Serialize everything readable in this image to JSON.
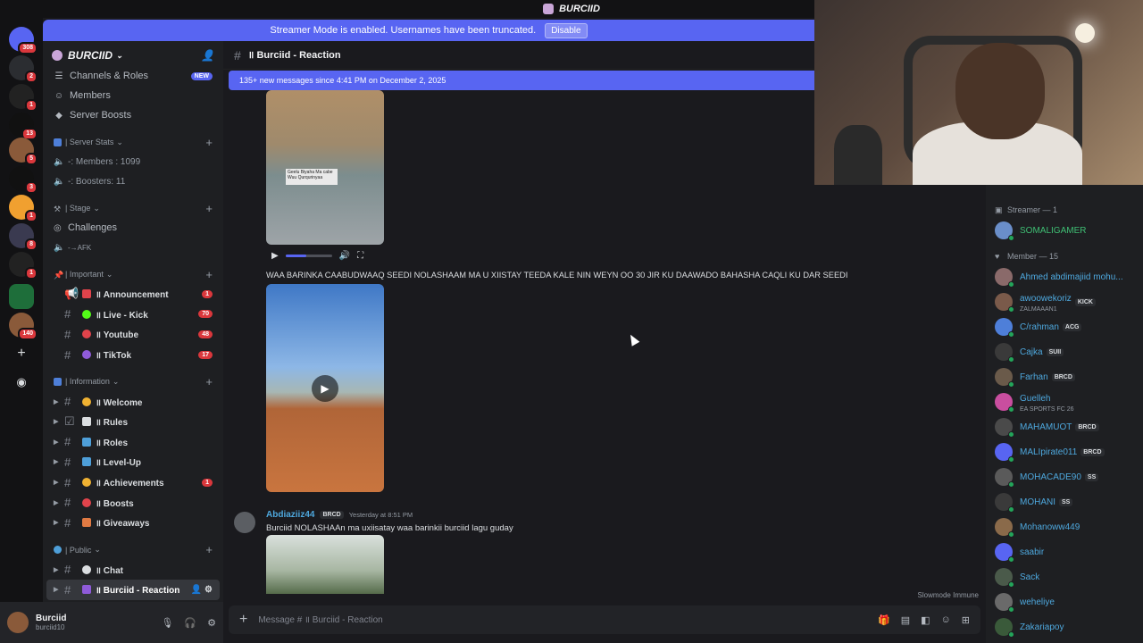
{
  "window": {
    "title": "BURCIID"
  },
  "streamer_banner": {
    "text": "Streamer Mode is enabled. Usernames have been truncated.",
    "button": "Disable"
  },
  "rail": [
    {
      "badge": "308"
    },
    {
      "badge": "2"
    },
    {
      "badge": "1"
    },
    {
      "badge": "13"
    },
    {
      "badge": "5"
    },
    {
      "badge": "3"
    },
    {
      "badge": "1"
    },
    {
      "badge": "8"
    },
    {
      "badge": "1"
    },
    {
      "badge": "140"
    }
  ],
  "server": {
    "name": "BURCIID"
  },
  "nav": {
    "channels_roles": "Channels & Roles",
    "new_badge": "NEW",
    "members": "Members",
    "boosts": "Server Boosts"
  },
  "categories": {
    "server_stats": "| Server Stats",
    "stage": "| Stage",
    "important": "| Important",
    "information": "| Information",
    "public": "| Public"
  },
  "stats": {
    "members": "-: Members : 1099",
    "boosters": "-: Boosters: 11"
  },
  "stage": {
    "challenges": "Challenges",
    "afk": "-→AFK"
  },
  "channels": {
    "announcement": {
      "label": "॥ Announcement",
      "count": "1"
    },
    "kick": {
      "label": "॥ Live - Kick",
      "count": "70"
    },
    "youtube": {
      "label": "॥ Youtube",
      "count": "48"
    },
    "tiktok": {
      "label": "॥ TikTok",
      "count": "17"
    },
    "welcome": {
      "label": "॥ Welcome"
    },
    "rules": {
      "label": "॥ Rules"
    },
    "roles": {
      "label": "॥ Roles"
    },
    "levelup": {
      "label": "॥ Level-Up"
    },
    "achievements": {
      "label": "॥ Achievements",
      "count": "1"
    },
    "boosts": {
      "label": "॥ Boosts"
    },
    "giveaways": {
      "label": "॥ Giveaways"
    },
    "chat": {
      "label": "॥ Chat"
    },
    "reaction": {
      "label": "॥ Burciid - Reaction"
    }
  },
  "user": {
    "name": "Burciid",
    "status": "burciid10"
  },
  "chat": {
    "channel_title": "॥ Burciid - Reaction",
    "new_messages": "135+ new messages since 4:41 PM on December 2, 2025",
    "video1_caption": "Geelu Biyaha Ma cabe Wuu Qurqurinyaa",
    "video1_progress": 0.45,
    "message1": "WAA BARINKA CAABUDWAAQ SEEDI NOLASHAAM MA U XIISTAY TEEDA KALE NIN WEYN OO 30 JIR KU DAAWADO BAHASHA CAQLI KU DAR SEEDI",
    "message2": {
      "author": "Abdiaziiz44",
      "tag": "BRCD",
      "time": "Yesterday at 8:51 PM",
      "text": "Burciid NOLASHAAn ma uxiisatay waa barinkii burciid lagu guday"
    },
    "slowmode": "Slowmode Immune",
    "composer_placeholder": "Message # ॥ Burciid - Reaction"
  },
  "members": {
    "top_status": "burciid10",
    "streamer_heading": "Streamer — 1",
    "streamers": [
      {
        "name": "SOMALIGAMER"
      }
    ],
    "member_heading": "Member — 15",
    "list": [
      {
        "name": "Ahmed abdimajiid mohu...",
        "tag": "",
        "sub": ""
      },
      {
        "name": "awoowekoriz",
        "tag": "KICK",
        "sub": "ZALMAAAN1"
      },
      {
        "name": "C/rahman",
        "tag": "ACG",
        "sub": ""
      },
      {
        "name": "Cajka",
        "tag": "SUII",
        "sub": ""
      },
      {
        "name": "Farhan",
        "tag": "BRCD",
        "sub": ""
      },
      {
        "name": "Guelleh",
        "tag": "",
        "sub": "EA SPORTS FC 26"
      },
      {
        "name": "MAHAMUOT",
        "tag": "BRCD",
        "sub": ""
      },
      {
        "name": "MALIpirate011",
        "tag": "BRCD",
        "sub": ""
      },
      {
        "name": "MOHACADE90",
        "tag": "SS",
        "sub": ""
      },
      {
        "name": "MOHANI",
        "tag": "SS",
        "sub": ""
      },
      {
        "name": "Mohanoww449",
        "tag": "",
        "sub": ""
      },
      {
        "name": "saabir",
        "tag": "",
        "sub": ""
      },
      {
        "name": "Sack",
        "tag": "",
        "sub": ""
      },
      {
        "name": "weheliye",
        "tag": "",
        "sub": ""
      },
      {
        "name": "Zakariapoy",
        "tag": "",
        "sub": ""
      }
    ]
  },
  "colors": {
    "accent": "#5865f2",
    "badge": "#da373c",
    "online": "#23a55a",
    "member_name": "#4ea8de"
  }
}
